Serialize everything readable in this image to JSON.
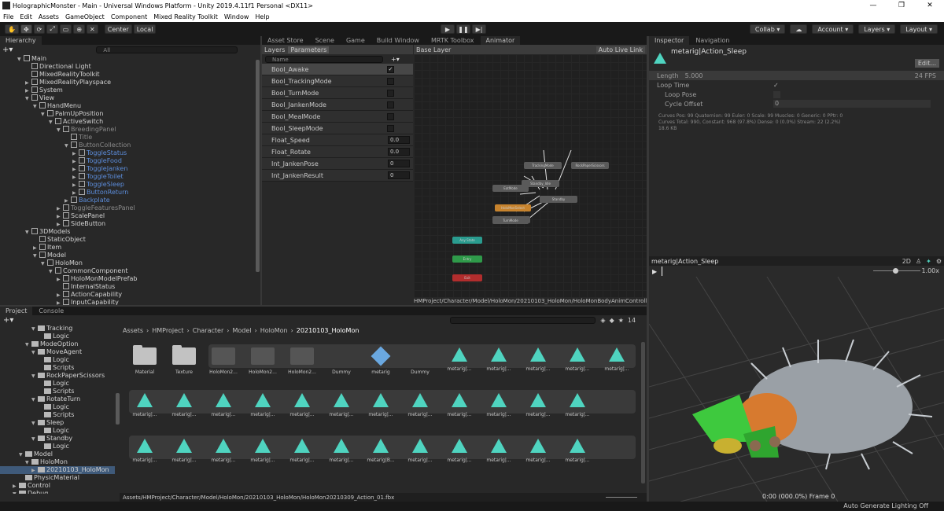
{
  "window": {
    "title": "HolographicMonster - Main - Universal Windows Platform - Unity 2019.4.11f1 Personal <DX11>",
    "min": "—",
    "max": "❐",
    "close": "✕"
  },
  "menu": [
    "File",
    "Edit",
    "Assets",
    "GameObject",
    "Component",
    "Mixed Reality Toolkit",
    "Window",
    "Help"
  ],
  "toolbar": {
    "tools": [
      "✋",
      "✥",
      "⟳",
      "⤢",
      "▭",
      "⊕",
      "✕"
    ],
    "center": "Center",
    "local": "Local",
    "play": "▶",
    "pause": "❚❚",
    "step": "▶|",
    "collab": "Collab ▾",
    "cloud": "☁",
    "account": "Account ▾",
    "layers": "Layers ▾",
    "layout": "Layout ▾"
  },
  "hierarchy": {
    "tab": "Hierarchy",
    "search_placeholder": "All",
    "items": [
      {
        "label": "Main",
        "indent": 0,
        "arrow": "▼",
        "style": ""
      },
      {
        "label": "Directional Light",
        "indent": 1,
        "arrow": "",
        "style": ""
      },
      {
        "label": "MixedRealityToolkit",
        "indent": 1,
        "arrow": "",
        "style": ""
      },
      {
        "label": "MixedRealityPlayspace",
        "indent": 1,
        "arrow": "▶",
        "style": ""
      },
      {
        "label": "System",
        "indent": 1,
        "arrow": "▶",
        "style": ""
      },
      {
        "label": "View",
        "indent": 1,
        "arrow": "▼",
        "style": ""
      },
      {
        "label": "HandMenu",
        "indent": 2,
        "arrow": "▼",
        "style": ""
      },
      {
        "label": "PalmUpPosition",
        "indent": 3,
        "arrow": "▼",
        "style": ""
      },
      {
        "label": "ActiveSwitch",
        "indent": 4,
        "arrow": "▼",
        "style": ""
      },
      {
        "label": "BreedingPanel",
        "indent": 5,
        "arrow": "▼",
        "style": "dim"
      },
      {
        "label": "Title",
        "indent": 6,
        "arrow": "",
        "style": "dim"
      },
      {
        "label": "ButtonCollection",
        "indent": 6,
        "arrow": "▼",
        "style": "dim"
      },
      {
        "label": "ToggleStatus",
        "indent": 7,
        "arrow": "▶",
        "style": "blue"
      },
      {
        "label": "ToggleFood",
        "indent": 7,
        "arrow": "▶",
        "style": "blue"
      },
      {
        "label": "ToggleJanken",
        "indent": 7,
        "arrow": "▶",
        "style": "blue"
      },
      {
        "label": "ToggleToilet",
        "indent": 7,
        "arrow": "▶",
        "style": "blue"
      },
      {
        "label": "ToggleSleep",
        "indent": 7,
        "arrow": "▶",
        "style": "blue"
      },
      {
        "label": "ButtonReturn",
        "indent": 7,
        "arrow": "▶",
        "style": "blue"
      },
      {
        "label": "Backplate",
        "indent": 6,
        "arrow": "▶",
        "style": "blue"
      },
      {
        "label": "ToggleFeaturesPanel",
        "indent": 5,
        "arrow": "▶",
        "style": "dim"
      },
      {
        "label": "ScalePanel",
        "indent": 5,
        "arrow": "▶",
        "style": ""
      },
      {
        "label": "SideButton",
        "indent": 5,
        "arrow": "▶",
        "style": ""
      },
      {
        "label": "3DModels",
        "indent": 1,
        "arrow": "▼",
        "style": ""
      },
      {
        "label": "StaticObject",
        "indent": 2,
        "arrow": "",
        "style": ""
      },
      {
        "label": "Item",
        "indent": 2,
        "arrow": "▶",
        "style": ""
      },
      {
        "label": "Model",
        "indent": 2,
        "arrow": "▼",
        "style": ""
      },
      {
        "label": "HoloMon",
        "indent": 3,
        "arrow": "▼",
        "style": ""
      },
      {
        "label": "CommonComponent",
        "indent": 4,
        "arrow": "▼",
        "style": ""
      },
      {
        "label": "HoloMonModelPrefab",
        "indent": 5,
        "arrow": "▶",
        "style": ""
      },
      {
        "label": "InternalStatus",
        "indent": 5,
        "arrow": "",
        "style": ""
      },
      {
        "label": "ActionCapability",
        "indent": 5,
        "arrow": "▶",
        "style": ""
      },
      {
        "label": "InputCapability",
        "indent": 5,
        "arrow": "▶",
        "style": ""
      }
    ]
  },
  "center_tabs": [
    "Asset Store",
    "Scene",
    "Game",
    "Build Window",
    "MRTK Toolbox",
    "Animator"
  ],
  "animator": {
    "layers_tab": "Layers",
    "params_tab": "Parameters",
    "search_placeholder": "Name",
    "add": "+▾",
    "base_layer": "Base Layer",
    "live_link": "Auto Live Link",
    "path": "HMProject/Character/Model/HoloMon/20210103_HoloMon/HoloMonBodyAnimController.controller",
    "params": [
      {
        "name": "Bool_Awake",
        "type": "bool",
        "value": "✓"
      },
      {
        "name": "Bool_TrackingMode",
        "type": "bool",
        "value": ""
      },
      {
        "name": "Bool_TurnMode",
        "type": "bool",
        "value": ""
      },
      {
        "name": "Bool_JankenMode",
        "type": "bool",
        "value": ""
      },
      {
        "name": "Bool_MealMode",
        "type": "bool",
        "value": ""
      },
      {
        "name": "Bool_SleepMode",
        "type": "bool",
        "value": ""
      },
      {
        "name": "Float_Speed",
        "type": "num",
        "value": "0.0"
      },
      {
        "name": "Float_Rotate",
        "type": "num",
        "value": "0.0"
      },
      {
        "name": "Int_JankenPose",
        "type": "num",
        "value": "0"
      },
      {
        "name": "Int_JankenResult",
        "type": "num",
        "value": "0"
      }
    ]
  },
  "inspector": {
    "tab": "Inspector",
    "nav_tab": "Navigation",
    "title": "metarig|Action_Sleep",
    "edit": "Edit...",
    "length_label": "Length",
    "length_value": "5.000",
    "fps": "24 FPS",
    "loop_time": "Loop Time",
    "loop_pose": "Loop Pose",
    "cycle_offset": "Cycle Offset",
    "cycle_value": "0",
    "stats1": "Curves Pos: 99 Quaternion: 99 Euler: 0 Scale: 99 Muscles: 0 Generic: 0 PPtr: 0",
    "stats2": "Curves Total: 990, Constant: 968 (97.8%) Dense: 0 (0.0%) Stream: 22 (2.2%)",
    "stats3": "18.6 KB",
    "preview_title": "metarig|Action_Sleep",
    "preview_2d": "2D",
    "speed": "1.00x",
    "frame": "0:00 (000.0%) Frame 0"
  },
  "project": {
    "tab": "Project",
    "console_tab": "Console",
    "count": "14",
    "breadcrumb": [
      "Assets",
      "HMProject",
      "Character",
      "Model",
      "HoloMon",
      "20210103_HoloMon"
    ],
    "tree": [
      {
        "label": "Tracking",
        "indent": 4,
        "arrow": "▼"
      },
      {
        "label": "Logic",
        "indent": 5,
        "arrow": ""
      },
      {
        "label": "ModeOption",
        "indent": 3,
        "arrow": "▼"
      },
      {
        "label": "MoveAgent",
        "indent": 4,
        "arrow": "▼"
      },
      {
        "label": "Logic",
        "indent": 5,
        "arrow": ""
      },
      {
        "label": "Scripts",
        "indent": 5,
        "arrow": ""
      },
      {
        "label": "RockPaperScissors",
        "indent": 4,
        "arrow": "▼"
      },
      {
        "label": "Logic",
        "indent": 5,
        "arrow": ""
      },
      {
        "label": "Scripts",
        "indent": 5,
        "arrow": ""
      },
      {
        "label": "RotateTurn",
        "indent": 4,
        "arrow": "▼"
      },
      {
        "label": "Logic",
        "indent": 5,
        "arrow": ""
      },
      {
        "label": "Scripts",
        "indent": 5,
        "arrow": ""
      },
      {
        "label": "Sleep",
        "indent": 4,
        "arrow": "▼"
      },
      {
        "label": "Logic",
        "indent": 5,
        "arrow": ""
      },
      {
        "label": "Standby",
        "indent": 4,
        "arrow": "▼"
      },
      {
        "label": "Logic",
        "indent": 5,
        "arrow": ""
      },
      {
        "label": "Model",
        "indent": 2,
        "arrow": "▼"
      },
      {
        "label": "HoloMon",
        "indent": 3,
        "arrow": "▼"
      },
      {
        "label": "20210103_HoloMon",
        "indent": 4,
        "arrow": "▶"
      },
      {
        "label": "PhysicMaterial",
        "indent": 2,
        "arrow": ""
      },
      {
        "label": "Control",
        "indent": 1,
        "arrow": "▶"
      },
      {
        "label": "Debug",
        "indent": 1,
        "arrow": "▼"
      },
      {
        "label": "Scripts",
        "indent": 2,
        "arrow": ""
      }
    ],
    "row1": [
      "Material",
      "Texture",
      "HoloMon2...",
      "HoloMon2...",
      "HoloMon2...",
      "Dummy",
      "metarig",
      "Dummy",
      "metarig|...",
      "metarig|...",
      "metarig|...",
      "metarig|...",
      "metarig|..."
    ],
    "row2": [
      "metarig|...",
      "metarig|...",
      "metarig|...",
      "metarig|...",
      "metarig|...",
      "metarig|...",
      "metarig|...",
      "metarig|...",
      "metarig|...",
      "metarig|...",
      "metarig|...",
      "metarig|..."
    ],
    "row3": [
      "metarig|...",
      "metarig|...",
      "metarig|...",
      "metarig|...",
      "metarig|...",
      "metarig|...",
      "metarig|B...",
      "metarig|...",
      "metarig|...",
      "metarig|...",
      "metarig|...",
      "metarig|..."
    ],
    "footer_path": "Assets/HMProject/Character/Model/HoloMon/20210103_HoloMon/HoloMon20210309_Action_01.fbx"
  },
  "status_bar": "Auto Generate Lighting Off"
}
